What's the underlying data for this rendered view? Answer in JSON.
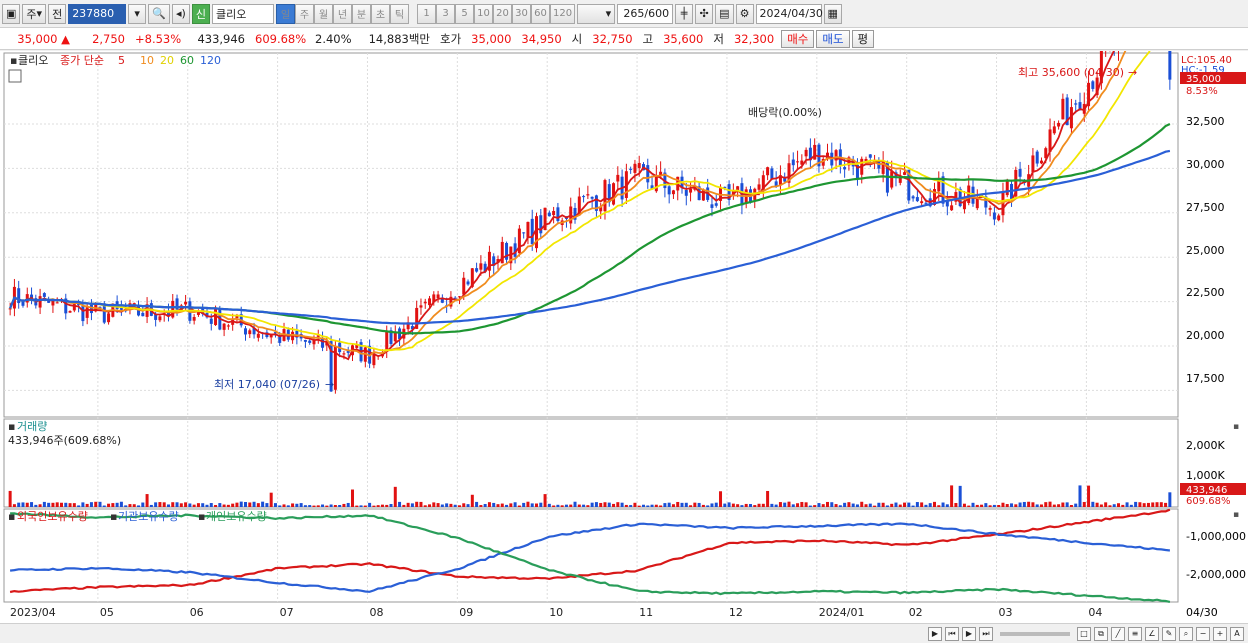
{
  "toolbar": {
    "type_label": "주",
    "prev_label": "전",
    "code": "237880",
    "badge": "신",
    "name": "클리오",
    "periods": [
      "일",
      "주",
      "월",
      "년",
      "분",
      "초",
      "틱"
    ],
    "active_period": "일",
    "intervals": [
      "1",
      "3",
      "5",
      "10",
      "20",
      "30",
      "60",
      "120"
    ],
    "count": "265",
    "count_total": "/600",
    "date": "2024/04/30"
  },
  "quote": {
    "price": "35,000",
    "change": "2,750",
    "change_pct": "+8.53%",
    "volume": "433,946",
    "volume_ratio": "609.68%",
    "turnover": "2.40%",
    "amount": "14,883백만",
    "bid_ask_label": "호가",
    "ask": "35,000",
    "bid": "34,950",
    "open_label": "시",
    "open": "32,750",
    "high_label": "고",
    "high": "35,600",
    "low_label": "저",
    "low": "32,300",
    "buy_label": "매수",
    "sell_label": "매도",
    "eval_label": "평"
  },
  "price_panel": {
    "legend_name": "클리오",
    "legend_ma_title": "종가 단순",
    "legend_ma": [
      "5",
      "10",
      "20",
      "60",
      "120"
    ],
    "lc_label": "LC:105.40",
    "hc_label": "HC:-1.59",
    "last_price_tag": "35,000",
    "last_pct_tag": "8.53%",
    "high_annot": "최고 35,600 (04/30)",
    "low_annot": "최저 17,040 (07/26)",
    "dividend_annot": "배당락(0.00%)",
    "y_ticks": [
      "32,500",
      "30,000",
      "27,500",
      "25,000",
      "22,500",
      "20,000",
      "17,500"
    ]
  },
  "volume_panel": {
    "title": "거래량",
    "value_label": "433,946주(609.68%)",
    "y_ticks": [
      "2,000K",
      "1,000K"
    ],
    "last_tag": "433,946",
    "last_pct_tag": "609.68%"
  },
  "holding_panel": {
    "legend": [
      "외국인보유수량",
      "기관보유수량",
      "개인보유수량"
    ],
    "y_ticks": [
      "-1,000,000",
      "-2,000,000"
    ]
  },
  "x_axis": {
    "labels": [
      "2023/04",
      "05",
      "06",
      "07",
      "08",
      "09",
      "10",
      "11",
      "12",
      "2024/01",
      "02",
      "03",
      "04"
    ],
    "last_label": "04/30"
  },
  "colors": {
    "up": "#e11111",
    "down": "#1a4fd6",
    "ma5": "#d81818",
    "ma10": "#f08c1e",
    "ma20": "#f2e600",
    "ma60": "#1e9632",
    "ma120": "#2a5fd6",
    "foreign": "#d81818",
    "institution": "#2a5fd6",
    "individual": "#2a9d5a"
  },
  "chart_data": {
    "type": "line",
    "title": "",
    "price_range": [
      16000,
      36500
    ],
    "ma_periods": [
      5,
      10,
      20,
      60,
      120
    ],
    "months": [
      "2023/04",
      "05",
      "06",
      "07",
      "08",
      "09",
      "10",
      "11",
      "12",
      "2024/01",
      "02",
      "03",
      "04"
    ],
    "monthly_close": [
      22800,
      21800,
      22000,
      20500,
      19500,
      23500,
      27200,
      29500,
      28000,
      31000,
      29000,
      27800,
      35000
    ],
    "series": [
      {
        "name": "종가",
        "values": [
          22800,
          21800,
          22000,
          20500,
          19500,
          23500,
          27200,
          29500,
          28000,
          31000,
          29000,
          27800,
          35000
        ]
      },
      {
        "name": "외국인보유수량",
        "values": [
          -2450000,
          -2350000,
          -2300000,
          -1900000,
          -1800000,
          -2100000,
          -2150000,
          -1950000,
          -1300000,
          -1250000,
          -1350000,
          -1100000,
          -800000
        ]
      },
      {
        "name": "기관보유수량",
        "values": [
          -1950000,
          -1900000,
          -2000000,
          -2250000,
          -2450000,
          -1900000,
          -1150000,
          -850000,
          -950000,
          -900000,
          -850000,
          -1100000,
          -1300000
        ]
      },
      {
        "name": "개인보유수량",
        "values": [
          -600000,
          -700000,
          -650000,
          -720000,
          -650000,
          -1200000,
          -1950000,
          -2450000,
          -2500000,
          -2450000,
          -2480000,
          -2400000,
          -2550000
        ]
      }
    ],
    "high": {
      "value": 35600,
      "date": "04/30"
    },
    "low": {
      "value": 17040,
      "date": "07/26"
    },
    "last": {
      "price": 35000,
      "change_pct": 8.53,
      "volume": 433946
    },
    "volume_ylim": [
      0,
      2600000
    ]
  }
}
